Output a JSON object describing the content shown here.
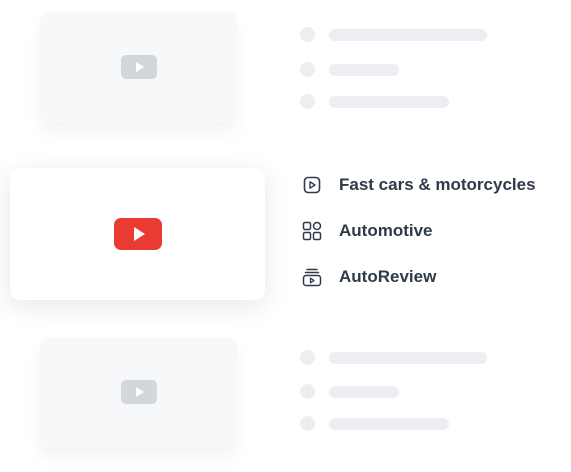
{
  "video_cards": [
    {
      "state": "placeholder",
      "icon": "play-icon",
      "color": "#d3d6db"
    },
    {
      "state": "selected",
      "icon": "youtube-play-icon",
      "color": "#ea3b33"
    },
    {
      "state": "placeholder",
      "icon": "play-icon",
      "color": "#d3d6db"
    }
  ],
  "details": {
    "title": "Fast cars & motorcycles",
    "title_icon": "video-play-icon",
    "category": "Automotive",
    "category_icon": "category-grid-icon",
    "channel": "AutoReview",
    "channel_icon": "channel-icon"
  },
  "colors": {
    "accent": "#ea3b33",
    "text": "#2f3a4a",
    "placeholder": "#eceef1"
  }
}
